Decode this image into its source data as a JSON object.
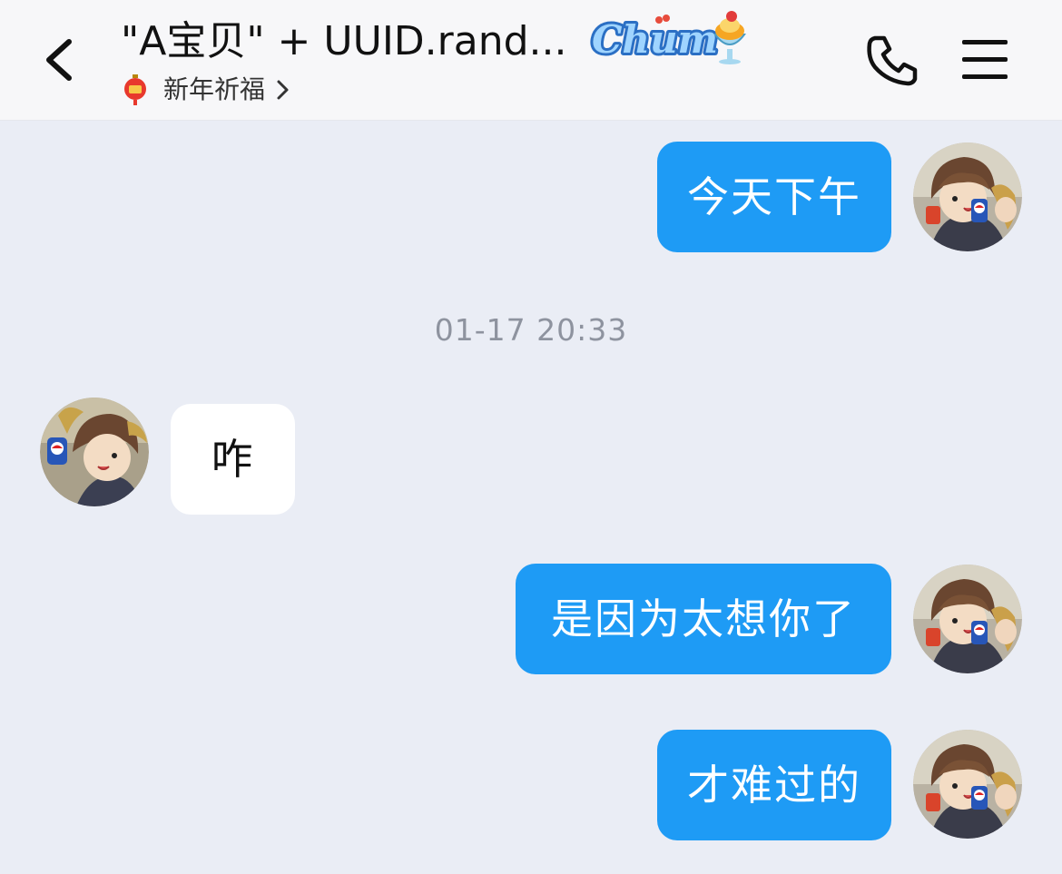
{
  "header": {
    "title": "\"A宝贝\" + UUID.rand...",
    "badge_text": "Chum",
    "subtitle": "新年祈福",
    "back_icon": "chevron-left-icon",
    "call_icon": "phone-icon",
    "menu_icon": "hamburger-menu-icon"
  },
  "messages": [
    {
      "direction": "outgoing",
      "text": "今天下午"
    },
    {
      "direction": "incoming",
      "text": "咋"
    },
    {
      "direction": "outgoing",
      "text": "是因为太想你了"
    },
    {
      "direction": "outgoing",
      "text": "才难过的"
    }
  ],
  "timestamp": "01-17 20:33",
  "colors": {
    "outgoing_bubble": "#1e9bf5",
    "incoming_bubble": "#ffffff",
    "chat_background": "#eaedf5",
    "header_background": "#f7f7f9"
  }
}
